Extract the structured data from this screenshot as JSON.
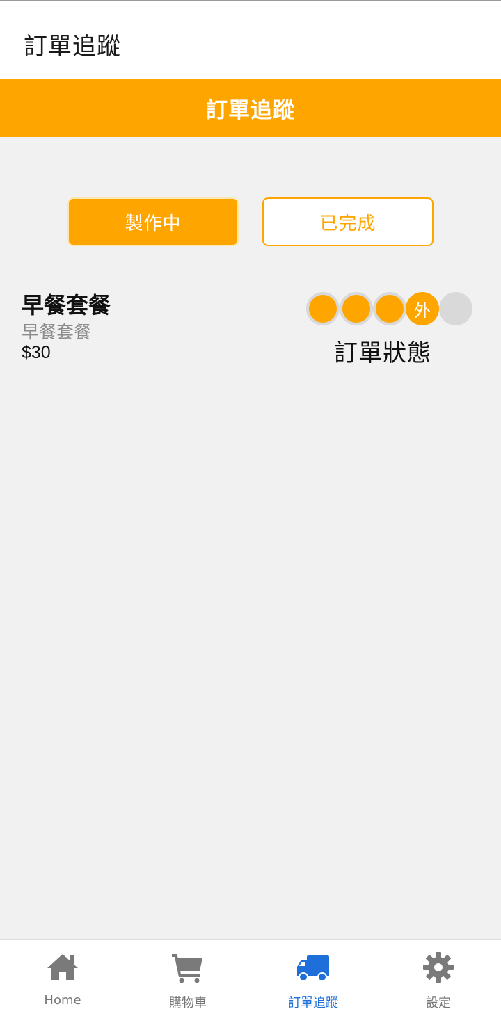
{
  "app_bar": {
    "title": "訂單追蹤"
  },
  "banner": {
    "title": "訂單追蹤"
  },
  "tabs": [
    {
      "label": "製作中",
      "active": true
    },
    {
      "label": "已完成",
      "active": false
    }
  ],
  "order": {
    "name": "早餐套餐",
    "subtitle": "早餐套餐",
    "price": "$30",
    "status_label": "訂單狀態",
    "status_steps": [
      {
        "state": "done",
        "text": ""
      },
      {
        "state": "done",
        "text": ""
      },
      {
        "state": "done",
        "text": ""
      },
      {
        "state": "current",
        "text": "外"
      },
      {
        "state": "pending",
        "text": ""
      }
    ]
  },
  "bottom_nav": [
    {
      "label": "Home",
      "icon": "home-icon",
      "active": false
    },
    {
      "label": "購物車",
      "icon": "cart-icon",
      "active": false
    },
    {
      "label": "訂單追蹤",
      "icon": "truck-icon",
      "active": true
    },
    {
      "label": "設定",
      "icon": "gear-icon",
      "active": false
    }
  ],
  "colors": {
    "accent": "#ffa500",
    "nav_active": "#1e6fd9",
    "nav_inactive": "#777777",
    "pending": "#d9d9d9"
  }
}
